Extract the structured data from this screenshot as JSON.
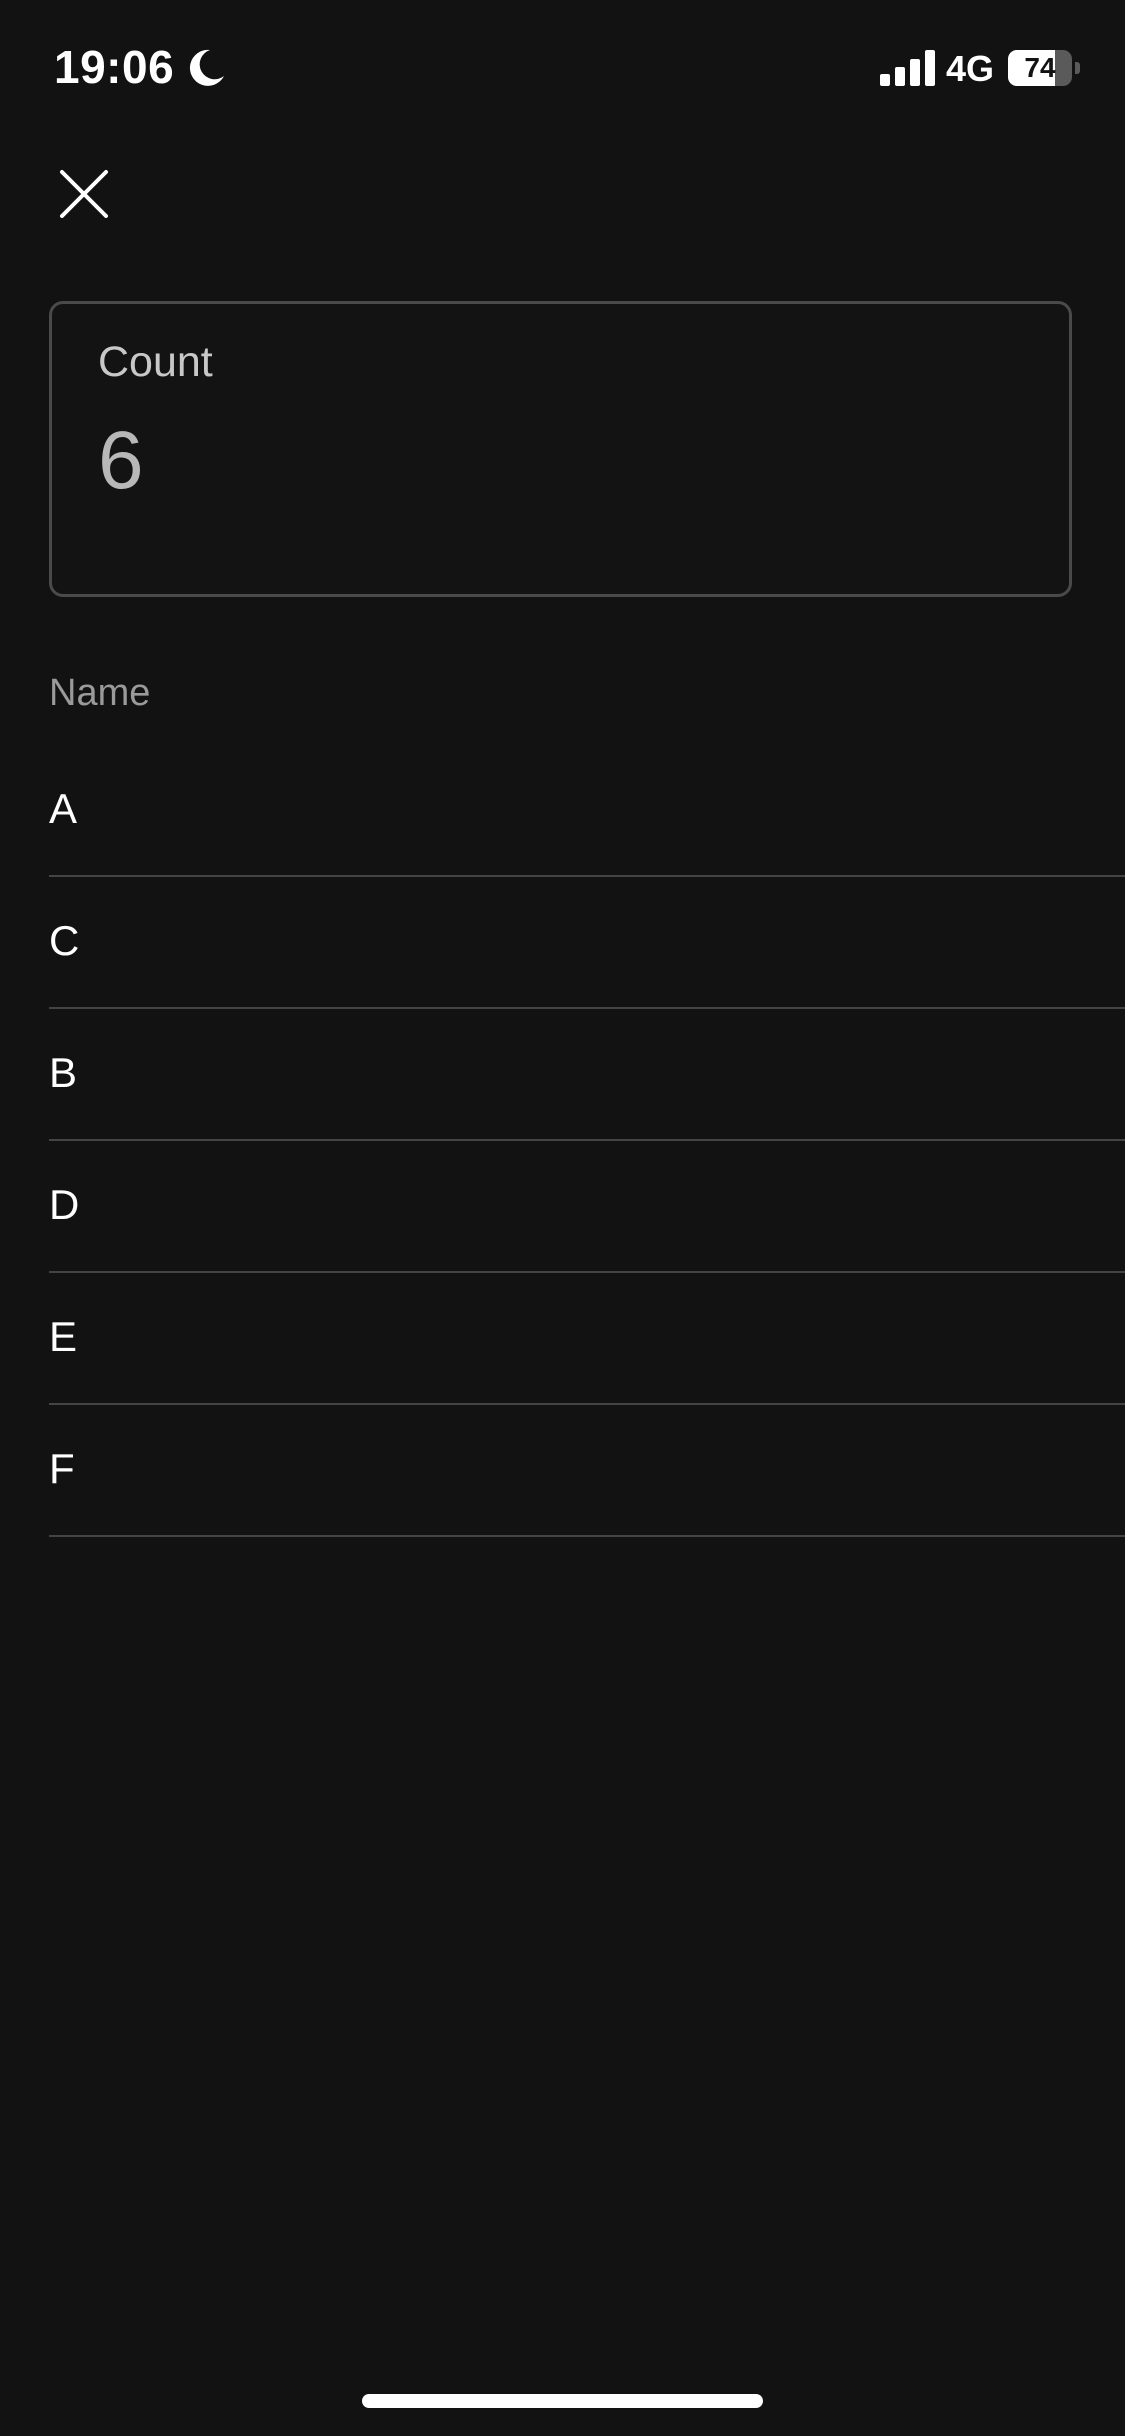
{
  "status_bar": {
    "time": "19:06",
    "network": "4G",
    "battery_percent": "74",
    "battery_level": 0.74,
    "icons": [
      "moon-icon",
      "signal-icon",
      "battery-icon"
    ]
  },
  "close_button": {
    "icon": "close-icon"
  },
  "count_card": {
    "label": "Count",
    "value": "6"
  },
  "list": {
    "header": "Name",
    "items": [
      {
        "label": "A"
      },
      {
        "label": "C"
      },
      {
        "label": "B"
      },
      {
        "label": "D"
      },
      {
        "label": "E"
      },
      {
        "label": "F"
      }
    ]
  },
  "colors": {
    "background": "#121212",
    "text": "#ffffff",
    "muted_text": "#9a9a9a",
    "divider": "#444444",
    "card_border": "#4a4a4a"
  }
}
